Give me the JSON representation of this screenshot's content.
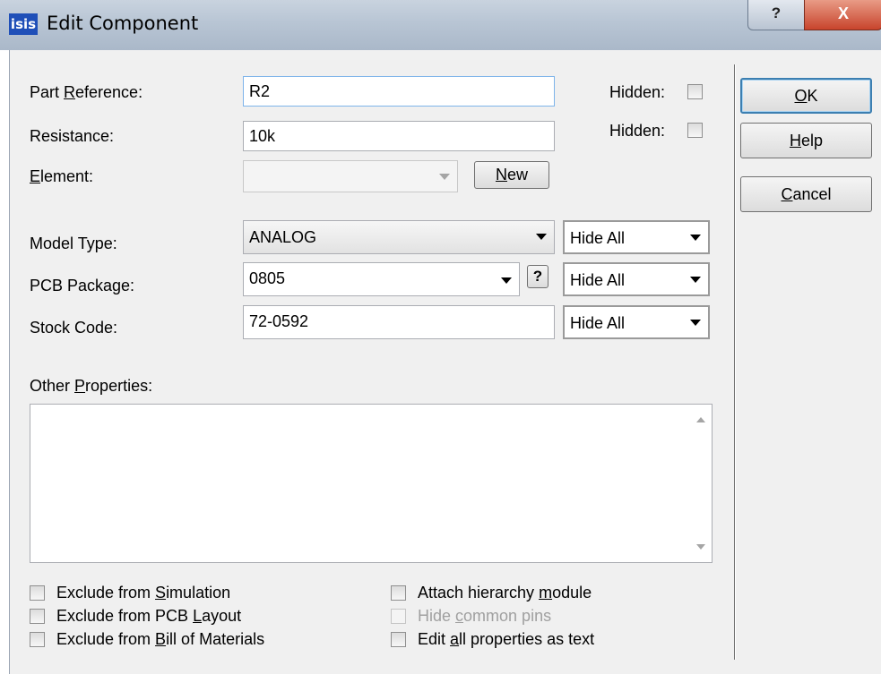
{
  "window": {
    "app_icon_text": "isis",
    "title": "Edit Component",
    "help_button": "?",
    "close_button": "X"
  },
  "fields": {
    "part_reference": {
      "label_pre": "Part ",
      "label_u": "R",
      "label_post": "eference:",
      "value": "R2",
      "hidden_label": "Hidden:"
    },
    "resistance": {
      "label": "Resistance:",
      "value": "10k",
      "hidden_label": "Hidden:"
    },
    "element": {
      "label_u": "E",
      "label_post": "lement:",
      "value": "",
      "new_pre": "",
      "new_u": "N",
      "new_post": "ew"
    },
    "model_type": {
      "label": "Model Type:",
      "value": "ANALOG",
      "visibility": "Hide All"
    },
    "pcb_package": {
      "label": "PCB Package:",
      "value": "0805",
      "help": "?",
      "visibility": "Hide All"
    },
    "stock_code": {
      "label": "Stock Code:",
      "value": "72-0592",
      "visibility": "Hide All"
    },
    "other_properties": {
      "label_pre": "Other ",
      "label_u": "P",
      "label_post": "roperties:",
      "value": ""
    }
  },
  "buttons": {
    "ok": {
      "u": "O",
      "rest": "K"
    },
    "help": {
      "u": "H",
      "rest": "elp"
    },
    "cancel": {
      "u": "C",
      "rest": "ancel"
    }
  },
  "options": {
    "exclude_simulation": {
      "pre": "Exclude from ",
      "u": "S",
      "post": "imulation"
    },
    "exclude_pcb": {
      "pre": "Exclude from PCB ",
      "u": "L",
      "post": "ayout"
    },
    "exclude_bom": {
      "pre": "Exclude from ",
      "u": "B",
      "post": "ill of Materials"
    },
    "attach_hierarchy": {
      "pre": "Attach hierarchy ",
      "u": "m",
      "post": "odule"
    },
    "hide_common_pins": {
      "pre": "Hide ",
      "u": "c",
      "post": "ommon pins"
    },
    "edit_all_text": {
      "pre": "Edit ",
      "u": "a",
      "post": "ll properties as text"
    }
  }
}
